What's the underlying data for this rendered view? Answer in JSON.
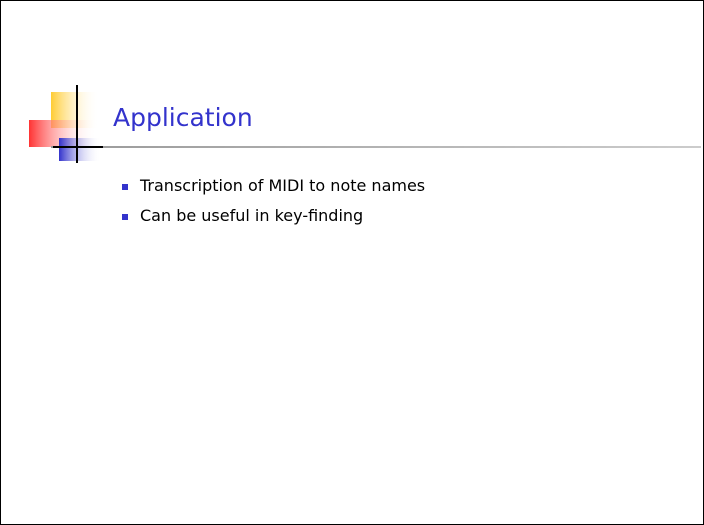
{
  "slide": {
    "title": "Application",
    "bullets": [
      "Transcription of MIDI to note names",
      "Can be useful in key-finding"
    ]
  },
  "colors": {
    "title": "#3333cc",
    "bullet_marker": "#3333cc",
    "deco_yellow": "#ffcc33",
    "deco_red": "#ff3333",
    "deco_blue": "#3333cc",
    "rule": "#999999",
    "cross": "#000000"
  }
}
